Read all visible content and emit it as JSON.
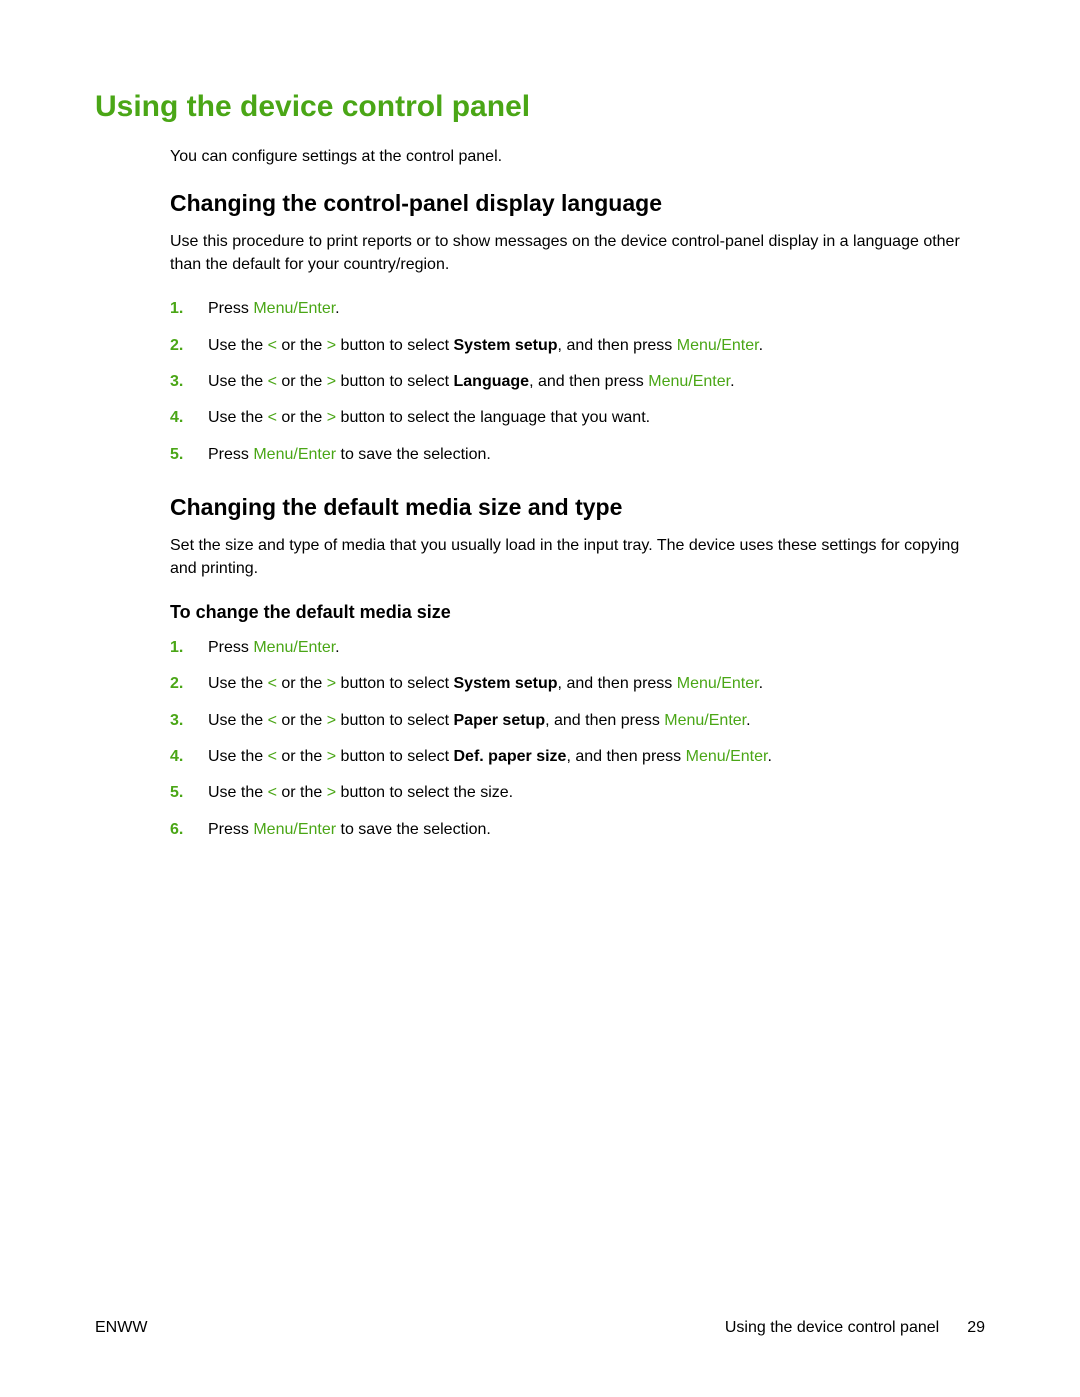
{
  "title": "Using the device control panel",
  "intro": "You can configure settings at the control panel.",
  "accent": "#4aa616",
  "sections": [
    {
      "heading": "Changing the control-panel display language",
      "para": "Use this procedure to print reports or to show messages on the device control-panel display in a language other than the default for your country/region.",
      "steps": [
        {
          "parts": [
            {
              "t": "Press "
            },
            {
              "t": "Menu/Enter",
              "hl": true
            },
            {
              "t": "."
            }
          ]
        },
        {
          "parts": [
            {
              "t": "Use the "
            },
            {
              "t": "<",
              "hl": true
            },
            {
              "t": " or the "
            },
            {
              "t": ">",
              "hl": true
            },
            {
              "t": " button to select "
            },
            {
              "t": "System setup",
              "b": true
            },
            {
              "t": ", and then press "
            },
            {
              "t": "Menu/Enter",
              "hl": true
            },
            {
              "t": "."
            }
          ]
        },
        {
          "parts": [
            {
              "t": "Use the "
            },
            {
              "t": "<",
              "hl": true
            },
            {
              "t": " or the "
            },
            {
              "t": ">",
              "hl": true
            },
            {
              "t": " button to select "
            },
            {
              "t": "Language",
              "b": true
            },
            {
              "t": ", and then press "
            },
            {
              "t": "Menu/Enter",
              "hl": true
            },
            {
              "t": "."
            }
          ]
        },
        {
          "parts": [
            {
              "t": "Use the "
            },
            {
              "t": "<",
              "hl": true
            },
            {
              "t": " or the "
            },
            {
              "t": ">",
              "hl": true
            },
            {
              "t": " button to select the language that you want."
            }
          ]
        },
        {
          "parts": [
            {
              "t": "Press "
            },
            {
              "t": "Menu/Enter",
              "hl": true
            },
            {
              "t": " to save the selection."
            }
          ]
        }
      ]
    },
    {
      "heading": "Changing the default media size and type",
      "para": "Set the size and type of media that you usually load in the input tray. The device uses these settings for copying and printing.",
      "subs": [
        {
          "heading": "To change the default media size",
          "steps": [
            {
              "parts": [
                {
                  "t": "Press "
                },
                {
                  "t": "Menu/Enter",
                  "hl": true
                },
                {
                  "t": "."
                }
              ]
            },
            {
              "parts": [
                {
                  "t": "Use the "
                },
                {
                  "t": "<",
                  "hl": true
                },
                {
                  "t": " or the "
                },
                {
                  "t": ">",
                  "hl": true
                },
                {
                  "t": " button to select "
                },
                {
                  "t": "System setup",
                  "b": true
                },
                {
                  "t": ", and then press "
                },
                {
                  "t": "Menu/Enter",
                  "hl": true
                },
                {
                  "t": "."
                }
              ]
            },
            {
              "parts": [
                {
                  "t": "Use the "
                },
                {
                  "t": "<",
                  "hl": true
                },
                {
                  "t": " or the "
                },
                {
                  "t": ">",
                  "hl": true
                },
                {
                  "t": " button to select "
                },
                {
                  "t": "Paper setup",
                  "b": true
                },
                {
                  "t": ", and then press "
                },
                {
                  "t": "Menu/Enter",
                  "hl": true
                },
                {
                  "t": "."
                }
              ]
            },
            {
              "parts": [
                {
                  "t": "Use the "
                },
                {
                  "t": "<",
                  "hl": true
                },
                {
                  "t": " or the "
                },
                {
                  "t": ">",
                  "hl": true
                },
                {
                  "t": " button to select "
                },
                {
                  "t": "Def. paper size",
                  "b": true
                },
                {
                  "t": ", and then press "
                },
                {
                  "t": "Menu/Enter",
                  "hl": true
                },
                {
                  "t": "."
                }
              ]
            },
            {
              "parts": [
                {
                  "t": "Use the "
                },
                {
                  "t": "<",
                  "hl": true
                },
                {
                  "t": " or the "
                },
                {
                  "t": ">",
                  "hl": true
                },
                {
                  "t": " button to select the size."
                }
              ]
            },
            {
              "parts": [
                {
                  "t": "Press "
                },
                {
                  "t": "Menu/Enter",
                  "hl": true
                },
                {
                  "t": " to save the selection."
                }
              ]
            }
          ]
        }
      ]
    }
  ],
  "footer": {
    "left": "ENWW",
    "right_text": "Using the device control panel",
    "page_no": "29"
  }
}
